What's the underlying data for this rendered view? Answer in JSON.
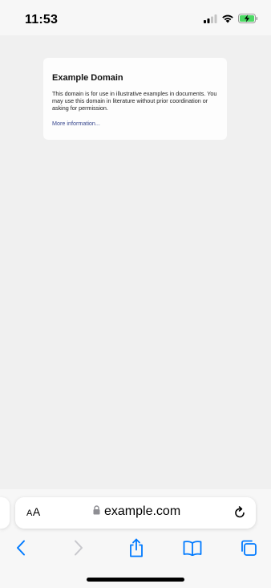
{
  "status_bar": {
    "time": "11:53",
    "icons": [
      "cellular-signal-icon",
      "wifi-icon",
      "battery-charging-icon"
    ],
    "battery_color": "#4cd964"
  },
  "page": {
    "title": "Example Domain",
    "body": "This domain is for use in illustrative examples in documents. You may use this domain in literature without prior coordination or asking for permission.",
    "link": "More information..."
  },
  "address_bar": {
    "aa_label_small": "A",
    "aa_label_large": "A",
    "url": "example.com",
    "icons": [
      "lock-icon",
      "reload-icon"
    ]
  },
  "toolbar": {
    "buttons": [
      "back-icon",
      "forward-icon",
      "share-icon",
      "bookmarks-icon",
      "tabs-icon"
    ],
    "accent_color": "#007aff",
    "disabled_color": "#c7c7cc"
  }
}
